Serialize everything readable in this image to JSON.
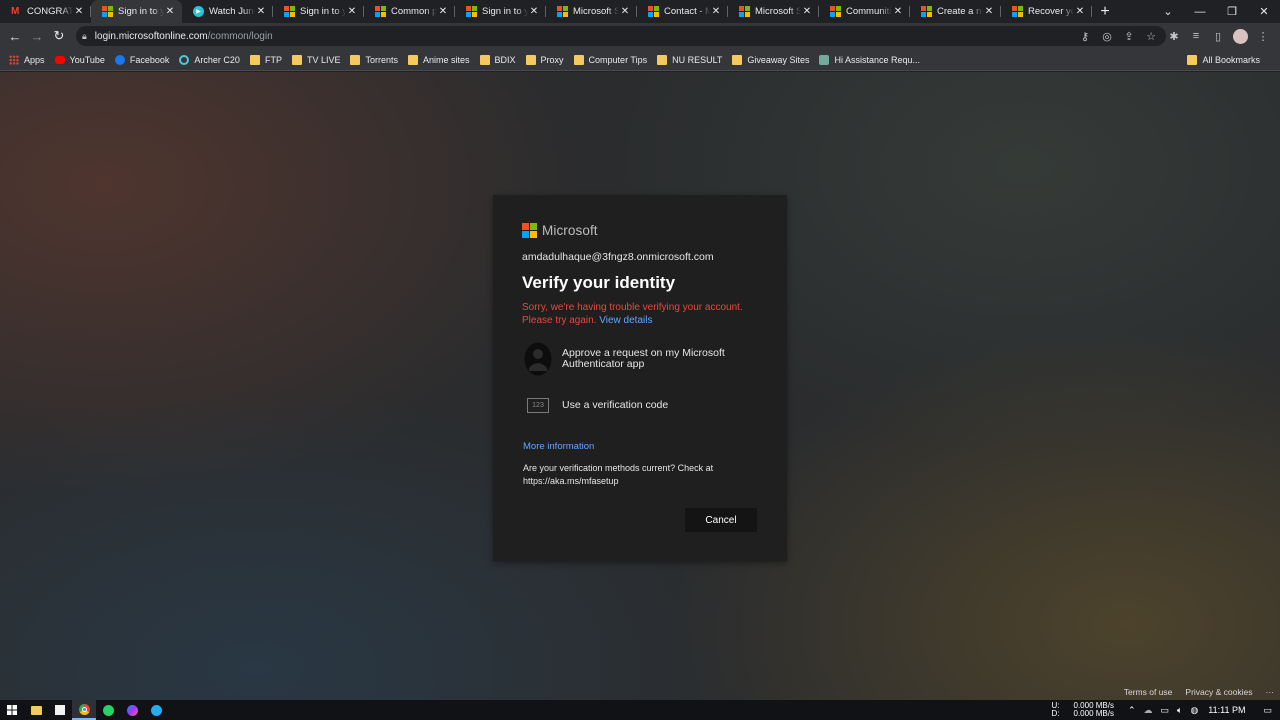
{
  "browser": {
    "tabs": [
      {
        "title": "CONGRATUL",
        "icon": "gmail-icon",
        "active": false
      },
      {
        "title": "Sign in to yo",
        "icon": "microsoft-icon",
        "active": true
      },
      {
        "title": "Watch Jungl",
        "icon": "play-icon",
        "active": false
      },
      {
        "title": "Sign in to yo",
        "icon": "microsoft-icon",
        "active": false
      },
      {
        "title": "Common pr",
        "icon": "microsoft-icon",
        "active": false
      },
      {
        "title": "Sign in to yo",
        "icon": "microsoft-icon",
        "active": false
      },
      {
        "title": "Microsoft Su",
        "icon": "microsoft-icon",
        "active": false
      },
      {
        "title": "Contact - M",
        "icon": "microsoft-icon",
        "active": false
      },
      {
        "title": "Microsoft Su",
        "icon": "microsoft-icon",
        "active": false
      },
      {
        "title": "Communitie",
        "icon": "microsoft-icon",
        "active": false
      },
      {
        "title": "Create a new",
        "icon": "microsoft-icon",
        "active": false
      },
      {
        "title": "Recover you",
        "icon": "microsoft-icon",
        "active": false
      }
    ],
    "url_host": "login.microsoftonline.com",
    "url_path": "/common/login"
  },
  "bookmarks": {
    "items": [
      "Apps",
      "YouTube",
      "Facebook",
      "Archer C20",
      "FTP",
      "TV LIVE",
      "Torrents",
      "Anime sites",
      "BDIX",
      "Proxy",
      "Computer Tips",
      "NU RESULT",
      "Giveaway Sites",
      "Hi Assistance Requ..."
    ],
    "all": "All Bookmarks"
  },
  "card": {
    "brand": "Microsoft",
    "email": "amdadulhaque@3fngz8.onmicrosoft.com",
    "heading": "Verify your identity",
    "error_text": "Sorry, we're having trouble verifying your account. Please try again.",
    "error_link": "View details",
    "options": [
      {
        "label": "Approve a request on my Microsoft Authenticator app",
        "icon": "authenticator-icon"
      },
      {
        "label": "Use a verification code",
        "icon": "code-123-icon",
        "icon_text": "123"
      }
    ],
    "more_info": "More information",
    "mfa_note": "Are your verification methods current? Check at https://aka.ms/mfasetup",
    "cancel": "Cancel"
  },
  "footer": {
    "terms": "Terms of use",
    "privacy": "Privacy & cookies",
    "more": "···"
  },
  "taskbar": {
    "net_up_label": "U:",
    "net_down_label": "D:",
    "net_up": "0.000 MB/s",
    "net_down": "0.000 MB/s",
    "time": "11:11 PM"
  },
  "colors": {
    "error": "#e8483c",
    "link": "#63a6ff",
    "card_bg": "#1f1f20",
    "ms_red": "#f25022",
    "ms_green": "#7fba00",
    "ms_blue": "#00a4ef",
    "ms_yellow": "#ffb900"
  }
}
